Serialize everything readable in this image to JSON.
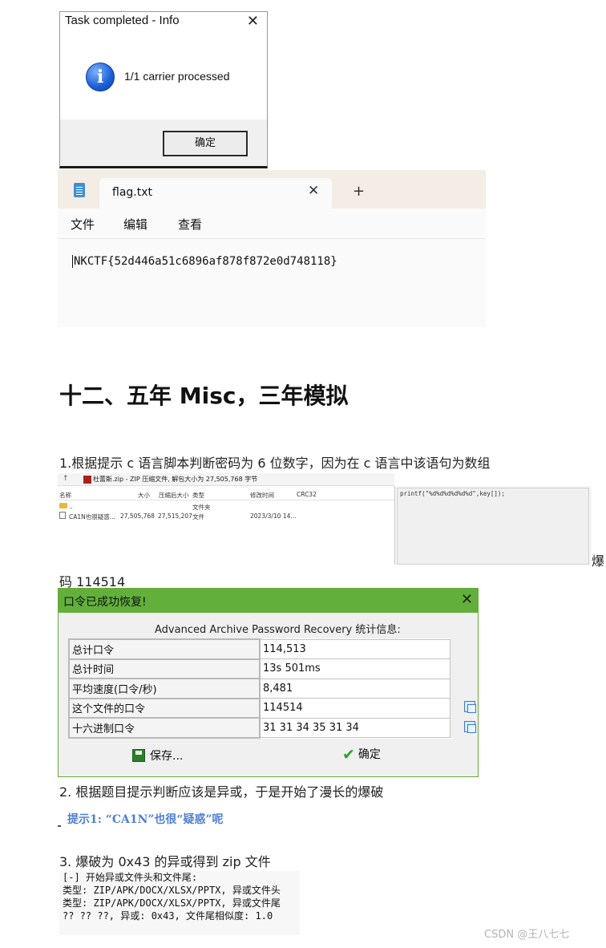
{
  "info_dialog": {
    "title": "Task completed - Info",
    "close_glyph": "✕",
    "icon_glyph": "i",
    "message": "1/1 carrier processed",
    "ok_label": "确定"
  },
  "notepad": {
    "tab_label": "flag.txt",
    "tab_close_glyph": "✕",
    "add_tab_glyph": "+",
    "menu": [
      "文件",
      "编辑",
      "查看"
    ],
    "content": "NKCTF{52d446a51c6896af878f872e0d748118}"
  },
  "heading": "十二、五年 Misc，三年模拟",
  "para1": "1.根据提示 c 语言脚本判断密码为 6 位数字，因为在 c 语言中该语句为数组",
  "para1_tail": "爆",
  "para1_cont": "码 114514",
  "archive": {
    "up_glyph": "↑",
    "header": "杜蕾斯.zip - ZIP 压缩文件, 解包大小为 27,505,768 字节",
    "columns": [
      "名称",
      "大小",
      "压缩后大小",
      "类型",
      "修改时间",
      "CRC32"
    ],
    "rows": [
      {
        "name": "..",
        "size": "",
        "packed": "",
        "type": "文件夹",
        "modified": "",
        "crc": ""
      },
      {
        "name": "CA1N也很疑惑...",
        "size": "27,505,768",
        "packed": "27,515,207",
        "type": "文件",
        "modified": "2023/3/10 14...",
        "crc": ""
      }
    ],
    "code": "printf(\"%d%d%d%d%d%d\",key[]);"
  },
  "recovery": {
    "title": "口令已成功恢复!",
    "close_glyph": "✕",
    "subtitle": "Advanced Archive Password Recovery 统计信息:",
    "rows": [
      {
        "label": "总计口令",
        "value": "114,513"
      },
      {
        "label": "总计时间",
        "value": "13s 501ms"
      },
      {
        "label": "平均速度(口令/秒)",
        "value": "8,481"
      },
      {
        "label": "这个文件的口令",
        "value": "114514"
      },
      {
        "label": "十六进制口令",
        "value": "31 31 34 35 31 34"
      }
    ],
    "save_label": "保存...",
    "ok_glyph": "✔",
    "ok_label": "确定"
  },
  "para2": "2.  根据题目提示判断应该是异或，于是开始了漫长的爆破",
  "hint": "提示1: “CA1N”也很“疑惑”呢",
  "para3": "3.  爆破为 0x43 的异或得到 zip 文件",
  "terminal": [
    "[-] 开始异或文件头和文件尾:",
    "类型: ZIP/APK/DOCX/XLSX/PPTX, 异或文件头",
    "类型: ZIP/APK/DOCX/XLSX/PPTX, 异或文件尾",
    "?? ?? ??, 异或: 0x43, 文件尾相似度: 1.0"
  ],
  "watermark": "CSDN @王八七七"
}
